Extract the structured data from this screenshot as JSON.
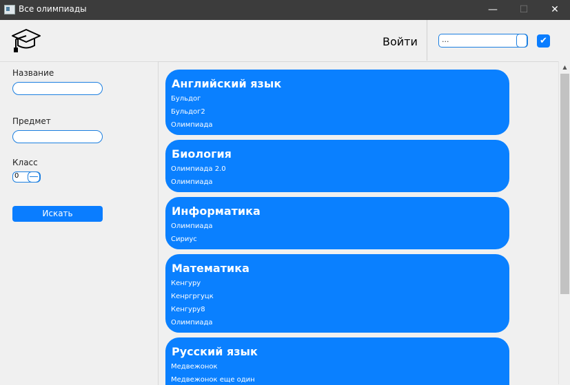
{
  "window": {
    "title": "Все олимпиады",
    "minimize": "—",
    "maximize": "☐",
    "close": "✕"
  },
  "header": {
    "login_label": "Войти",
    "combo_value": "...",
    "checkbox_mark": "✔"
  },
  "filters": {
    "name_label": "Название",
    "subject_label": "Предмет",
    "class_label": "Класс",
    "class_value": "0",
    "search_label": "Искать"
  },
  "subjects": [
    {
      "title": "Английский язык",
      "items": [
        "Бульдог",
        "Бульдог2",
        "Олимпиада"
      ]
    },
    {
      "title": "Биология",
      "items": [
        "Олимпиада 2.0",
        "Олимпиада"
      ]
    },
    {
      "title": "Информатика",
      "items": [
        "Олимпиада",
        "Сириус"
      ]
    },
    {
      "title": "Математика",
      "items": [
        "Кенгуру",
        "Кенргргуцк",
        "Кенгуру8",
        "Олимпиада"
      ]
    },
    {
      "title": "Русский язык",
      "items": [
        "Медвежонок",
        "Медвежонок еще один"
      ]
    }
  ],
  "colors": {
    "accent": "#0a80ff",
    "titlebar": "#3c3c3c",
    "background": "#f0f0f0"
  },
  "icons": {
    "app": "app-icon",
    "logo": "graduation-cap-icon",
    "scroll_up": "scroll-up-icon"
  }
}
